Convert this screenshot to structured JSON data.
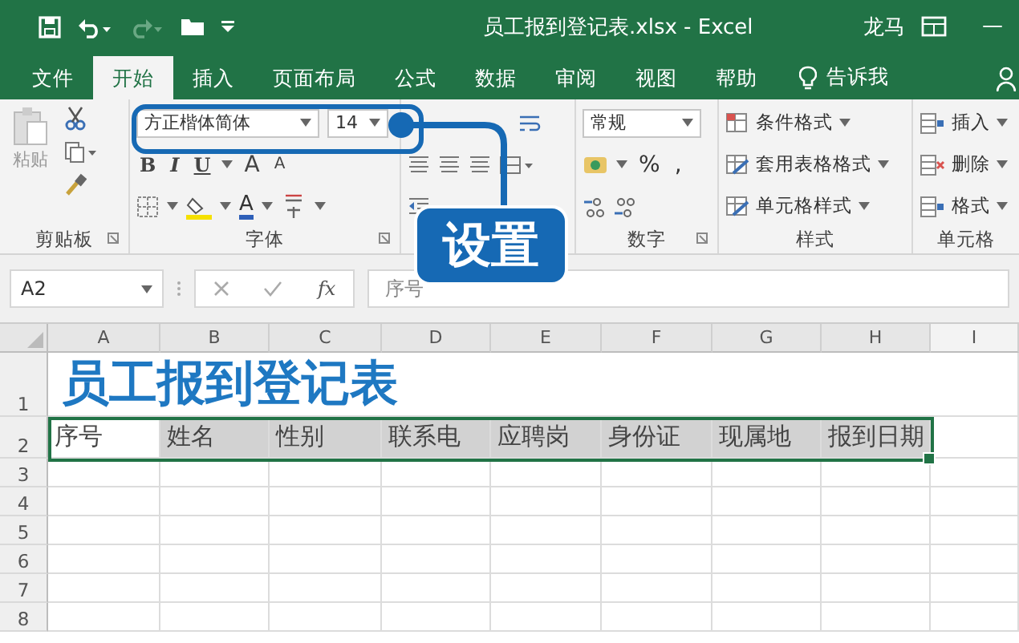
{
  "title_bar": {
    "document_title": "员工报到登记表.xlsx  -  Excel",
    "user": "龙马",
    "minimize": "—"
  },
  "tabs": [
    {
      "label": "文件",
      "selected": false
    },
    {
      "label": "开始",
      "selected": true
    },
    {
      "label": "插入",
      "selected": false
    },
    {
      "label": "页面布局",
      "selected": false
    },
    {
      "label": "公式",
      "selected": false
    },
    {
      "label": "数据",
      "selected": false
    },
    {
      "label": "审阅",
      "selected": false
    },
    {
      "label": "视图",
      "selected": false
    },
    {
      "label": "帮助",
      "selected": false
    }
  ],
  "tell_me": "告诉我",
  "ribbon": {
    "clipboard": {
      "paste": "粘贴",
      "label": "剪贴板"
    },
    "font": {
      "font_name": "方正楷体简体",
      "font_size": "14",
      "bold": "B",
      "italic": "I",
      "underline": "U",
      "grow": "A",
      "shrink": "A",
      "font_color": "A",
      "label": "字体"
    },
    "number": {
      "format": "常规",
      "percent": "%",
      "comma": ",",
      "label": "数字"
    },
    "styles": {
      "items": [
        "条件格式",
        "套用表格格式",
        "单元格样式"
      ],
      "label": "样式"
    },
    "cells": {
      "items": [
        "插入",
        "删除",
        "格式"
      ],
      "label": "单元格"
    }
  },
  "callout": {
    "text": "设置"
  },
  "formula_bar": {
    "name_box": "A2",
    "fx": "fx",
    "formula": "序号"
  },
  "sheet": {
    "columns": [
      "A",
      "B",
      "C",
      "D",
      "E",
      "F",
      "G",
      "H",
      "I"
    ],
    "title_row": {
      "number": "1",
      "title": "员工报到登记表"
    },
    "header_row": {
      "number": "2",
      "cells": [
        {
          "text": "序号",
          "active": true
        },
        {
          "text": "姓名",
          "active": false
        },
        {
          "text": "性别",
          "active": false
        },
        {
          "text": "联系电",
          "active": false
        },
        {
          "text": "应聘岗",
          "active": false
        },
        {
          "text": "身份证",
          "active": false
        },
        {
          "text": "现属地",
          "active": false
        },
        {
          "text": "报到日期",
          "active": false
        }
      ]
    },
    "empty_rows": [
      "3",
      "4",
      "5",
      "6",
      "7",
      "8"
    ]
  }
}
